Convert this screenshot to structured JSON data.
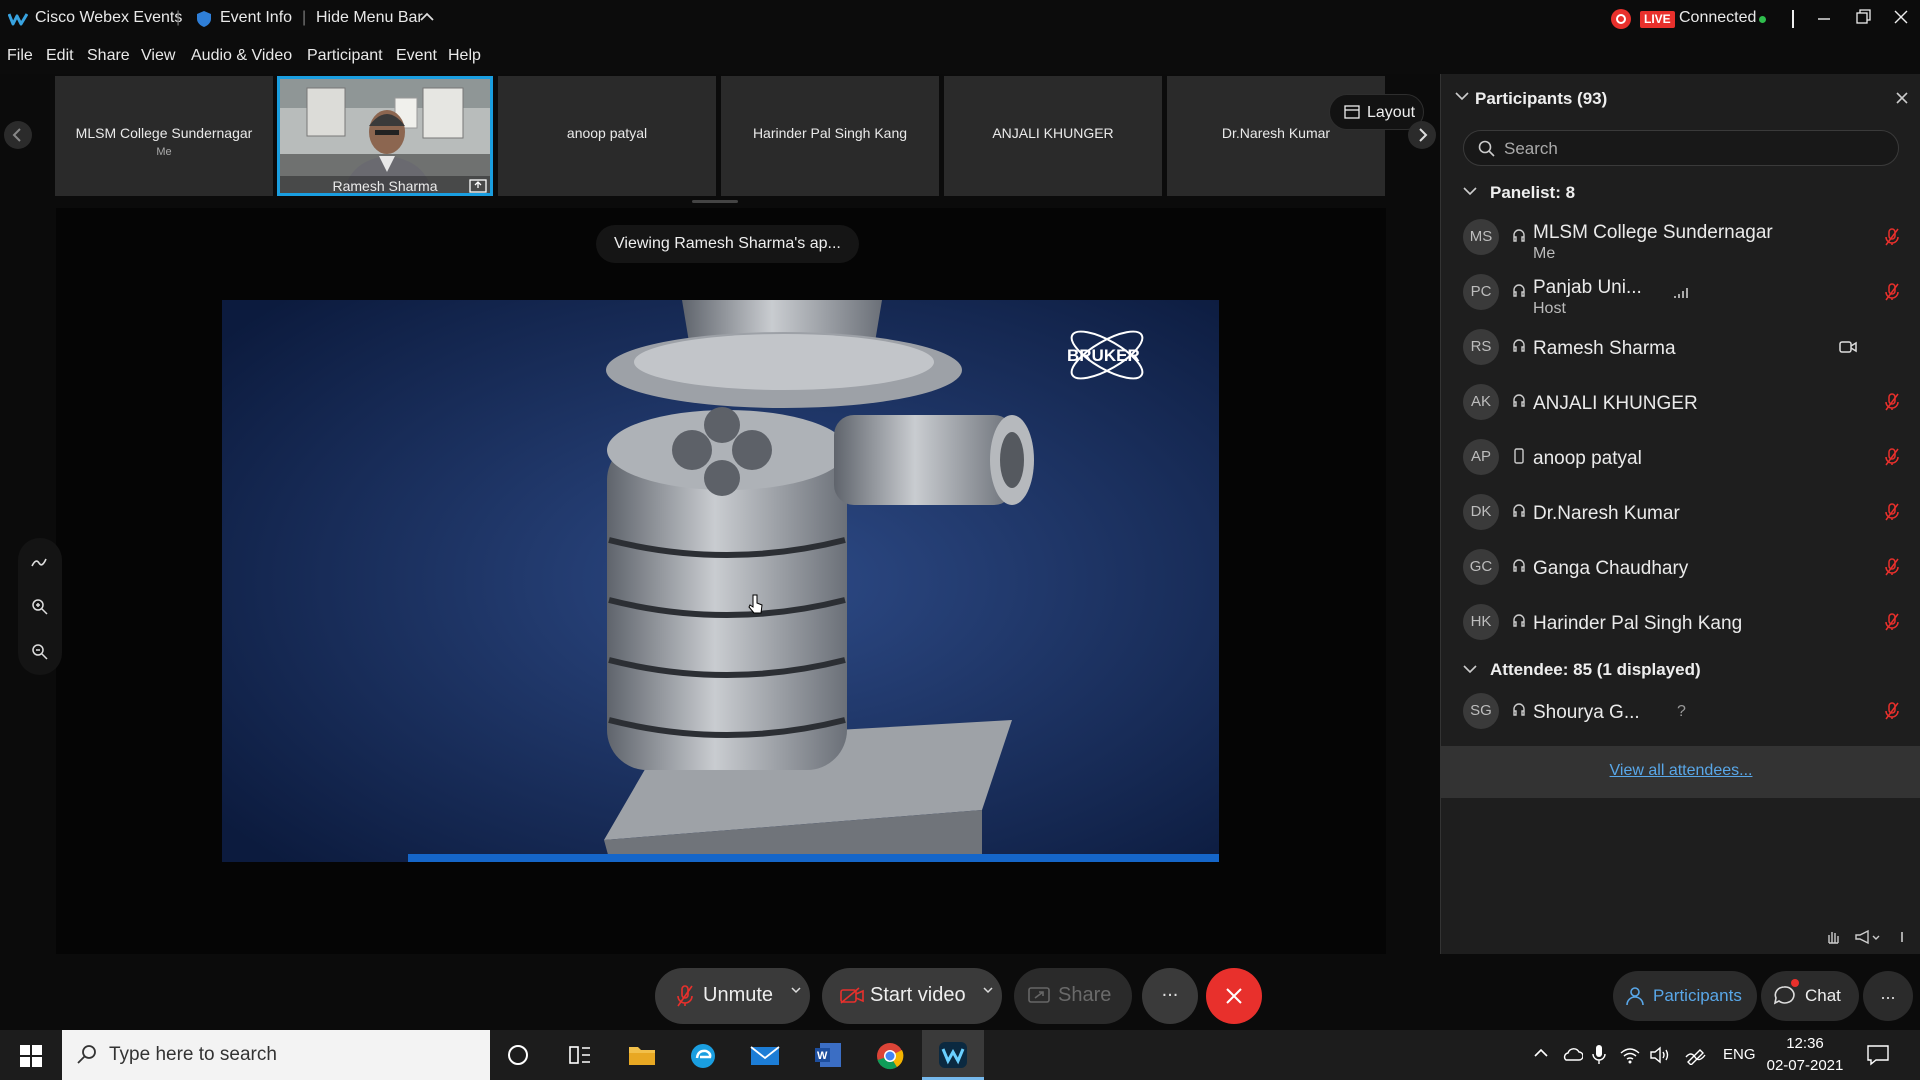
{
  "titlebar": {
    "app_title": "Cisco Webex Events",
    "event_info": "Event Info",
    "hide_menu": "Hide Menu Bar",
    "live_badge": "LIVE",
    "connected": "Connected"
  },
  "menubar": {
    "items": [
      "File",
      "Edit",
      "Share",
      "View",
      "Audio & Video",
      "Participant",
      "Event",
      "Help"
    ]
  },
  "filmstrip": {
    "tiles": [
      {
        "name": "MLSM College Sundernagar",
        "sub": "Me"
      },
      {
        "name": "Ramesh Sharma",
        "sub": ""
      },
      {
        "name": "anoop patyal",
        "sub": ""
      },
      {
        "name": "Harinder Pal Singh Kang",
        "sub": ""
      },
      {
        "name": "ANJALI KHUNGER",
        "sub": ""
      },
      {
        "name": "Dr.Naresh Kumar",
        "sub": ""
      }
    ],
    "layout_label": "Layout"
  },
  "stage": {
    "viewing_label": "Viewing Ramesh Sharma's ap...",
    "watermark": "BRUKER"
  },
  "participants_panel": {
    "title": "Participants (93)",
    "search_placeholder": "Search",
    "panelist_header": "Panelist: 8",
    "attendee_header": "Attendee: 85 (1 displayed)",
    "panelists": [
      {
        "initials": "MS",
        "name": "MLSM College Sundernagar",
        "role": "Me"
      },
      {
        "initials": "PC",
        "name": "Panjab Uni...",
        "role": "Host"
      },
      {
        "initials": "RS",
        "name": "Ramesh Sharma",
        "role": ""
      },
      {
        "initials": "AK",
        "name": "ANJALI KHUNGER",
        "role": ""
      },
      {
        "initials": "AP",
        "name": "anoop patyal",
        "role": ""
      },
      {
        "initials": "DK",
        "name": "Dr.Naresh Kumar",
        "role": ""
      },
      {
        "initials": "GC",
        "name": "Ganga Chaudhary",
        "role": ""
      },
      {
        "initials": "HK",
        "name": "Harinder Pal Singh Kang",
        "role": ""
      }
    ],
    "attendees": [
      {
        "initials": "SG",
        "name": "Shourya G...",
        "role": "",
        "extra": "?"
      }
    ],
    "view_all": "View all attendees..."
  },
  "controls": {
    "unmute": "Unmute",
    "start_video": "Start video",
    "share": "Share",
    "more": "...",
    "participants": "Participants",
    "chat": "Chat"
  },
  "taskbar": {
    "search_placeholder": "Type here to search",
    "language": "ENG",
    "time": "12:36",
    "date": "02-07-2021"
  },
  "colors": {
    "accent": "#1a9ee0",
    "end": "#e8302c",
    "live": "#e8302c",
    "link": "#59a7e8",
    "unmute_icon": "#e8302c"
  }
}
